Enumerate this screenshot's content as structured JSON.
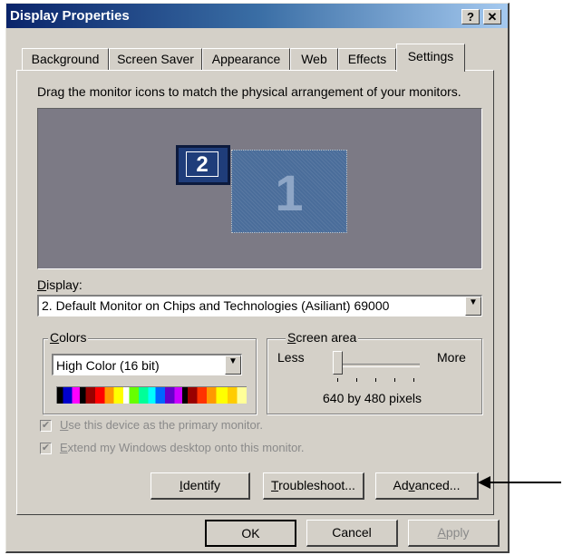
{
  "window": {
    "title": "Display Properties",
    "help_label": "?",
    "close_label": "✕"
  },
  "tabs": [
    {
      "label": "Background"
    },
    {
      "label": "Screen Saver"
    },
    {
      "label": "Appearance"
    },
    {
      "label": "Web"
    },
    {
      "label": "Effects"
    },
    {
      "label": "Settings",
      "active": true
    }
  ],
  "instruction": "Drag the monitor icons to match the physical arrangement of your monitors.",
  "monitors": {
    "secondary_label": "2",
    "primary_label": "1"
  },
  "display": {
    "label_accel": "D",
    "label_rest": "isplay:",
    "value": "2. Default Monitor on Chips and Technologies (Asiliant) 69000"
  },
  "colors": {
    "label_accel": "C",
    "label_rest": "olors",
    "value": "High Color (16 bit)"
  },
  "screen_area": {
    "label_accel": "S",
    "label_rest": "creen area",
    "less_label": "Less",
    "more_label": "More",
    "resolution": "640 by 480 pixels",
    "slider_position": 0
  },
  "checkboxes": [
    {
      "accel": "U",
      "rest": "se this device as the primary monitor.",
      "checked": true,
      "enabled": false
    },
    {
      "accel": "E",
      "rest": "xtend my Windows desktop onto this monitor.",
      "checked": true,
      "enabled": false
    }
  ],
  "buttons": {
    "identify": {
      "accel": "I",
      "rest": "dentify"
    },
    "troubleshoot": {
      "accel": "T",
      "rest": "roubleshoot..."
    },
    "advanced_pre": "Ad",
    "advanced_accel": "v",
    "advanced_post": "anced...",
    "ok": "OK",
    "cancel": "Cancel",
    "apply": {
      "accel": "A",
      "rest": "pply"
    }
  },
  "colors_theme": {
    "face": "#d4d0c8",
    "title_active": "#0a246a",
    "monitor_bg": "#7c7a85",
    "monitor_primary": "#4a6d9a",
    "monitor_secondary": "#1f3d7a"
  }
}
